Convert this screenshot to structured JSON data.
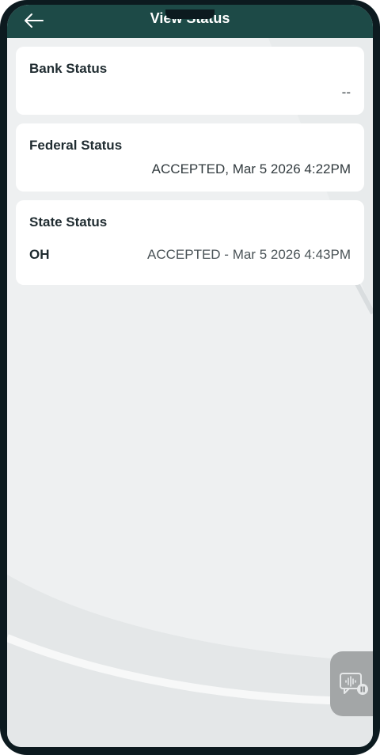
{
  "header": {
    "title": "View Status",
    "back_icon": "arrow-left-icon"
  },
  "bank": {
    "title": "Bank Status",
    "value": "--"
  },
  "federal": {
    "title": "Federal Status",
    "value": "ACCEPTED, Mar 5 2026 4:22PM"
  },
  "state": {
    "title": "State Status",
    "code": "OH",
    "value": "ACCEPTED - Mar 5 2026 4:43PM"
  },
  "chat": {
    "icon": "voice-chat-icon"
  },
  "colors": {
    "header_bg": "#1d4a47",
    "screen_bg": "#eef0f1",
    "card_bg": "#ffffff",
    "fab_bg": "#a3a6a7"
  }
}
